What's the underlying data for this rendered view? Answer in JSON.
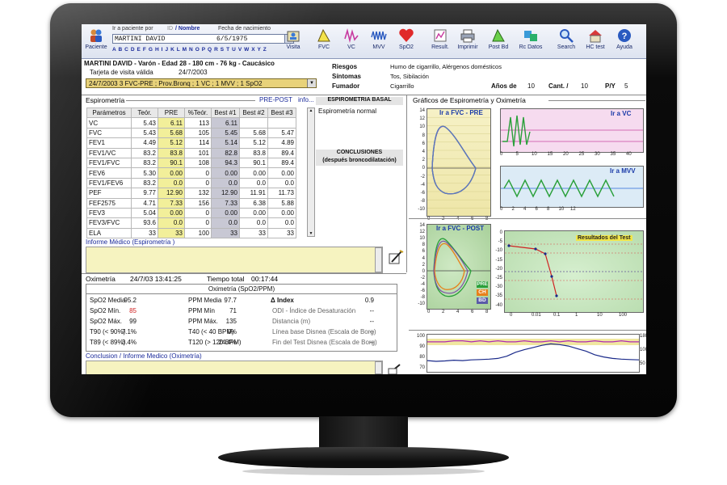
{
  "toolbar": {
    "paciente": "Paciente",
    "ir_a_paciente_por": "Ir a paciente por",
    "id": "ID",
    "nombre": "/ Nombre",
    "fecha_nacimiento_lbl": "Fecha de nacimiento",
    "patient_value": "MARTINI DAVID",
    "birth_value": "6/5/1975",
    "alphabet": "A B C D E F G H I J K L M N O P Q R S T U V W X Y Z",
    "visita": "Visita",
    "fvc": "FVC",
    "vc": "VC",
    "mvv": "MVV",
    "spo2": "SpO2",
    "result": "Result.",
    "imprimir": "Imprimir",
    "post_bd": "Post Bd",
    "rc_datos": "Rc Datos",
    "search": "Search",
    "hc_test": "HC test",
    "ayuda": "Ayuda"
  },
  "patient": {
    "summary": "MARTINI DAVID - Varón - Edad 28 - 180 cm - 76 kg - Caucásico",
    "tarjeta_lbl": "Tarjeta de visita válida",
    "tarjeta_val": "24/7/2003",
    "visit_select": "24/7/2003            3 FVC-PRE ; Prov.Bronq ; 1 VC ; 1 MVV ; 1 SpO2",
    "riesgos_lbl": "Riesgos",
    "riesgos_val": "Humo de cigarrillo, Alérgenos domésticos",
    "sintomas_lbl": "Síntomas",
    "sintomas_val": "Tos, Sibilación",
    "fumador_lbl": "Fumador",
    "fumador_val": "Cigarrillo",
    "anos_lbl": "Años de",
    "anos_val": "10",
    "cant_lbl": "Cant. /",
    "cant_val": "10",
    "py_lbl": "P/Y",
    "py_val": "5"
  },
  "spiro": {
    "title": "Espirometría",
    "prepost": "PRE-POST",
    "info": "info...",
    "headers": [
      "Parámetros",
      "Teór.",
      "PRE",
      "%Teór.",
      "Best #1",
      "Best #2",
      "Best #3"
    ],
    "rows": [
      [
        "VC",
        "5.43",
        "6.11",
        "113",
        "6.11",
        "",
        ""
      ],
      [
        "FVC",
        "5.43",
        "5.68",
        "105",
        "5.45",
        "5.68",
        "5.47"
      ],
      [
        "FEV1",
        "4.49",
        "5.12",
        "114",
        "5.14",
        "5.12",
        "4.89"
      ],
      [
        "FEV1/VC",
        "83.2",
        "83.8",
        "101",
        "82.8",
        "83.8",
        "89.4"
      ],
      [
        "FEV1/FVC",
        "83.2",
        "90.1",
        "108",
        "94.3",
        "90.1",
        "89.4"
      ],
      [
        "FEV6",
        "5.30",
        "0.00",
        "0",
        "0.00",
        "0.00",
        "0.00"
      ],
      [
        "FEV1/FEV6",
        "83.2",
        "0.0",
        "0",
        "0.0",
        "0.0",
        "0.0"
      ],
      [
        "PEF",
        "9.77",
        "12.90",
        "132",
        "12.90",
        "11.91",
        "11.73"
      ],
      [
        "FEF2575",
        "4.71",
        "7.33",
        "156",
        "7.33",
        "6.38",
        "5.88"
      ],
      [
        "FEV3",
        "5.04",
        "0.00",
        "0",
        "0.00",
        "0.00",
        "0.00"
      ],
      [
        "FEV3/FVC",
        "93.6",
        "0.0",
        "0",
        "0.0",
        "0.0",
        "0.0"
      ],
      [
        "ELA",
        "33",
        "33",
        "100",
        "33",
        "33",
        "33"
      ]
    ],
    "basal_title": "ESPIROMETRIA BASAL",
    "basal_text": "Espirometría normal",
    "conclusiones": "CONCLUSIONES",
    "despues": "(después broncodilatación)",
    "informe": "Informe Médico (Espirometría )"
  },
  "oxi": {
    "title": "Oximetría",
    "date": "24/7/03 13:41:25",
    "tiempo_lbl": "Tiempo total",
    "tiempo_val": "00:17:44",
    "sub_title": "Oximetría (SpO2/PPM)",
    "rows": [
      [
        "SpO2 Media",
        "95.2",
        "PPM Media",
        "97.7",
        "Δ Index",
        "0.9"
      ],
      [
        "SpO2 Mín.",
        "85",
        "PPM Mín",
        "71",
        "ODI - Índice de Desaturación",
        "--"
      ],
      [
        "SpO2 Máx.",
        "99",
        "PPM Máx.",
        "135",
        "Distancia (m)",
        "--"
      ],
      [
        "T90 (< 90%)",
        "7.1%",
        "T40 (< 40 BPM)",
        "0%",
        "Línea base Disnea (Escala de Borg)",
        "--"
      ],
      [
        "T89 (< 89%)",
        "3.4%",
        "T120 (> 120 BPM)",
        "24.4%",
        "Fin del Test Disnea (Escala de Borg)",
        "--"
      ]
    ],
    "conclusion": "Conclusion / Informe Medico (Oximetría)"
  },
  "charts": {
    "title": "Gráficos de Espirometría y Oximetría",
    "ir_fvc_pre": "Ir a FVC - PRE",
    "ir_vc": "Ir a VC",
    "ir_mvv": "Ir a MVV",
    "ir_fvc_post": "Ir a FVC - POST",
    "resultados": "Resultados del Test",
    "legend_pre": "PRE",
    "legend_ch": "CH",
    "legend_bd": "BD",
    "fvc_pre_y_ticks": [
      "14",
      "12",
      "10",
      "8",
      "6",
      "4",
      "2",
      "0",
      "-2",
      "-4",
      "-6",
      "-8",
      "-10"
    ],
    "fvc_pre_x_ticks": [
      "0",
      "2",
      "4",
      "6",
      "8"
    ],
    "vc_x_ticks": [
      "0",
      "5",
      "10",
      "15",
      "20",
      "25",
      "30",
      "35",
      "40"
    ],
    "mvv_x_ticks": [
      "0",
      "2",
      "4",
      "6",
      "8",
      "10",
      "12"
    ],
    "fvc_post_y_ticks": [
      "14",
      "12",
      "10",
      "8",
      "6",
      "4",
      "2",
      "0",
      "-2",
      "-4",
      "-6",
      "-8",
      "-10"
    ],
    "fvc_post_x_ticks": [
      "0",
      "2",
      "4",
      "6",
      "8"
    ],
    "res_y_ticks": [
      "0",
      "-5",
      "-10",
      "-15",
      "-20",
      "-25",
      "-30",
      "-35",
      "-40"
    ],
    "res_x_ticks": [
      "0",
      "0.01",
      "0.1",
      "1",
      "10",
      "100"
    ],
    "oxi_y_left": [
      "100",
      "90",
      "80",
      "70"
    ],
    "oxi_y_right": [
      "180",
      "100",
      "50"
    ],
    "oxi_spo2": [
      97,
      97,
      97,
      98,
      98,
      97,
      98,
      97,
      98,
      97,
      97,
      98,
      97,
      97,
      98,
      97,
      98,
      97,
      97,
      98,
      97,
      97,
      98,
      97,
      97
    ],
    "oxi_ppm": [
      82,
      80,
      81,
      83,
      82,
      84,
      85,
      86,
      88,
      94,
      105,
      112,
      118,
      124,
      128,
      126,
      122,
      115,
      108,
      98,
      92,
      88,
      86,
      85,
      84
    ]
  }
}
